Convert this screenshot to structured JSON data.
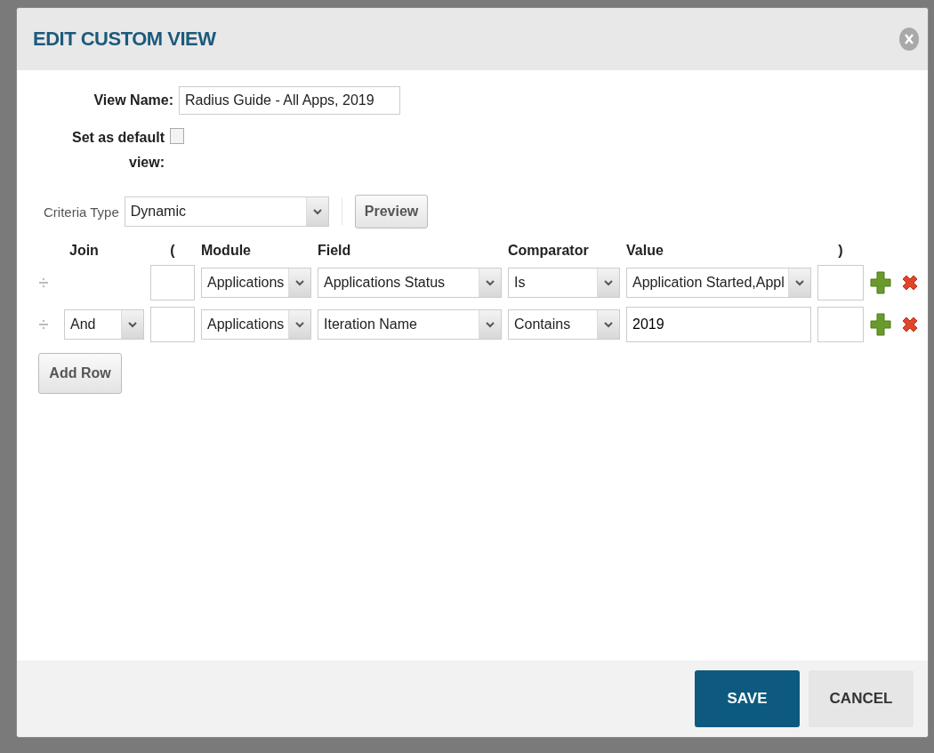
{
  "dialog": {
    "title": "EDIT CUSTOM VIEW"
  },
  "view_name": {
    "label": "View Name:",
    "value": "Radius Guide - All Apps, 2019"
  },
  "default_view": {
    "label": "Set as default view:",
    "checked": false
  },
  "criteria_type": {
    "label": "Criteria Type",
    "value": "Dynamic",
    "button": "Preview"
  },
  "criteria": {
    "columns": [
      "Join",
      "(",
      "Module",
      "Field",
      "Comparator",
      "Value",
      ")"
    ],
    "rows": [
      {
        "join": "",
        "open_paren": "",
        "module": "Applications",
        "field": "Applications Status",
        "comparator": "Is",
        "value": "Application Started,Appl",
        "kind": "select",
        "close_paren": ""
      },
      {
        "join": "And",
        "open_paren": "",
        "module": "Applications",
        "field": "Iteration Name",
        "comparator": "Contains",
        "value": "2019",
        "kind": "text",
        "close_paren": ""
      }
    ]
  },
  "add_row": "Add Row",
  "buttons": [
    {
      "label": "SAVE",
      "kind": "primary"
    },
    {
      "label": "CANCEL",
      "kind": "secondary"
    }
  ]
}
